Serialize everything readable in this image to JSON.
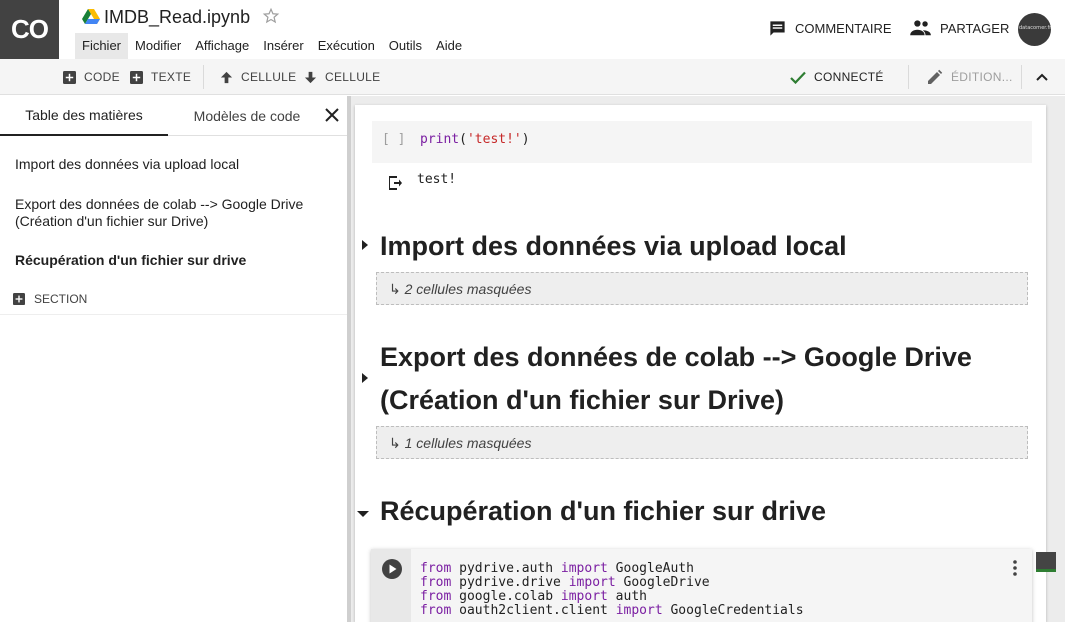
{
  "app": {
    "logo_text": "CO",
    "title": "IMDB_Read.ipynb"
  },
  "menu": [
    "Fichier",
    "Modifier",
    "Affichage",
    "Insérer",
    "Exécution",
    "Outils",
    "Aide"
  ],
  "header_actions": {
    "comment": "COMMENTAIRE",
    "share": "PARTAGER",
    "avatar_text": "datacorner.fr"
  },
  "toolbar": {
    "code": "CODE",
    "text": "TEXTE",
    "cell_up": "CELLULE",
    "cell_down": "CELLULE",
    "connected": "CONNECTÉ",
    "editing": "ÉDITION..."
  },
  "sidebar": {
    "tabs": [
      "Table des matières",
      "Modèles de code"
    ],
    "toc": [
      "Import des données via upload local",
      "Export des données de colab --> Google Drive (Création d'un fichier sur Drive)",
      "Récupération d'un fichier sur drive"
    ],
    "section_label": "SECTION"
  },
  "notebook": {
    "cell1": {
      "exec": "[ ]",
      "code_fn": "print",
      "code_open": "(",
      "code_str": "'test!'",
      "code_close": ")",
      "output": "test!"
    },
    "sections": [
      {
        "heading": "Import des données via upload local",
        "hidden": "↳ 2 cellules masquées"
      },
      {
        "heading_line1": "Export des données de colab --> Google Drive",
        "heading_line2": "(Création d'un fichier sur Drive)",
        "hidden": "↳ 1 cellules masquées"
      },
      {
        "heading": "Récupération d'un fichier sur drive"
      }
    ],
    "cell2": {
      "lines": [
        {
          "kw1": "from",
          "mod": " pydrive.auth ",
          "kw2": "import",
          "name": " GoogleAuth"
        },
        {
          "kw1": "from",
          "mod": " pydrive.drive ",
          "kw2": "import",
          "name": " GoogleDrive"
        },
        {
          "kw1": "from",
          "mod": " google.colab ",
          "kw2": "import",
          "name": " auth"
        },
        {
          "kw1": "from",
          "mod": " oauth2client.client ",
          "kw2": "import",
          "name": " GoogleCredentials"
        }
      ]
    }
  },
  "colors": {
    "logo_bg": "#424242",
    "connected_check": "#2e7d32",
    "keyword": "#7b1fa2",
    "string": "#c62828"
  }
}
